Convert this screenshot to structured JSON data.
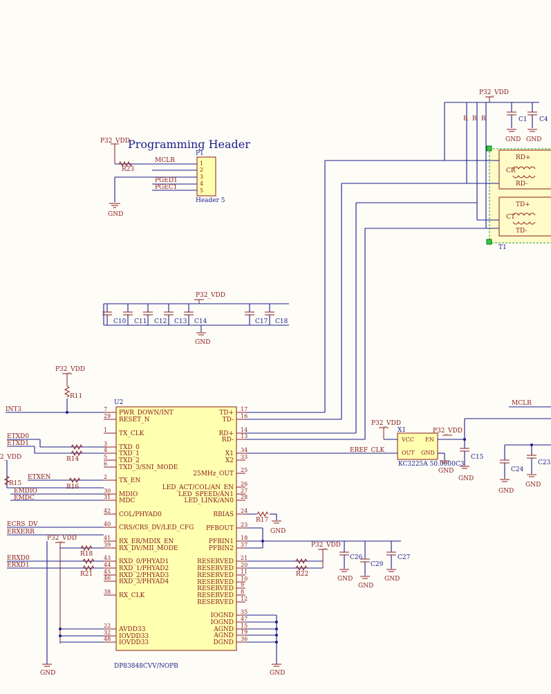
{
  "header": {
    "title": "Programming Header",
    "ref": "P1",
    "part": "Header 5",
    "pins": [
      "1",
      "2",
      "3",
      "4",
      "5"
    ],
    "nets": [
      "MCLR",
      "PGED1",
      "PGEC1"
    ]
  },
  "power": {
    "vdd": "P32_VDD",
    "gnd": "GND",
    "vdd_left": "2_VDD"
  },
  "caps_top": [
    "C1",
    "C4"
  ],
  "caps_bank": [
    "C10",
    "C11",
    "C12",
    "C13",
    "C14",
    "C17",
    "C18"
  ],
  "transformer": {
    "ref": "T1",
    "labels": [
      "RD+",
      "RD-",
      "TD+",
      "TD-"
    ],
    "cr": "CR",
    "ct": "CT"
  },
  "ic": {
    "ref": "U2",
    "part": "DP83848CVV/NOPB",
    "left_pins": [
      {
        "num": "7",
        "name": "PWR_DOWN/INT"
      },
      {
        "num": "29",
        "name": "RESET_N"
      },
      {
        "num": "1",
        "name": "TX_CLK"
      },
      {
        "num": "3",
        "name": "TXD_0"
      },
      {
        "num": "4",
        "name": "TXD_1"
      },
      {
        "num": "5",
        "name": "TXD_2"
      },
      {
        "num": "6",
        "name": "TXD_3/SNI_MODE"
      },
      {
        "num": "2",
        "name": "TX_EN"
      },
      {
        "num": "30",
        "name": "MDIO"
      },
      {
        "num": "31",
        "name": "MDC"
      },
      {
        "num": "42",
        "name": "COL/PHYAD0"
      },
      {
        "num": "40",
        "name": "CRS/CRS_DV/LED_CFG"
      },
      {
        "num": "41",
        "name": "RX_ER/MDIX_EN"
      },
      {
        "num": "39",
        "name": "RX_DV/MII_MODE"
      },
      {
        "num": "43",
        "name": "RXD_0/PHYAD1"
      },
      {
        "num": "44",
        "name": "RXD_1/PHYAD2"
      },
      {
        "num": "45",
        "name": "RXD_2/PHYAD3"
      },
      {
        "num": "46",
        "name": "RXD_3/PHYAD4"
      },
      {
        "num": "38",
        "name": "RX_CLK"
      },
      {
        "num": "22",
        "name": "AVDD33"
      },
      {
        "num": "32",
        "name": "IOVDD33"
      },
      {
        "num": "48",
        "name": "IOVDD33"
      }
    ],
    "right_pins": [
      {
        "num": "17",
        "name": "TD+"
      },
      {
        "num": "16",
        "name": "TD-"
      },
      {
        "num": "14",
        "name": "RD+"
      },
      {
        "num": "13",
        "name": "RD-"
      },
      {
        "num": "34",
        "name": "X1"
      },
      {
        "num": "33",
        "name": "X2"
      },
      {
        "num": "25",
        "name": "25MHz_OUT"
      },
      {
        "num": "26",
        "name": "LED_ACT/COL/AN_EN"
      },
      {
        "num": "27",
        "name": "LED_SPEED/AN1"
      },
      {
        "num": "28",
        "name": "LED_LINK/AN0"
      },
      {
        "num": "24",
        "name": "RBIAS"
      },
      {
        "num": "23",
        "name": "PFBOUT"
      },
      {
        "num": "18",
        "name": "PFBIN1"
      },
      {
        "num": "37",
        "name": "PFBIN2"
      },
      {
        "num": "21",
        "name": "RESERVED"
      },
      {
        "num": "20",
        "name": "RESERVED"
      },
      {
        "num": "11",
        "name": "RESERVED"
      },
      {
        "num": "10",
        "name": "RESERVED"
      },
      {
        "num": "9",
        "name": "RESERVED"
      },
      {
        "num": "8",
        "name": "RESERVED"
      },
      {
        "num": "12",
        "name": "RESERVED"
      },
      {
        "num": "35",
        "name": "IOGND"
      },
      {
        "num": "47",
        "name": "IOGND"
      },
      {
        "num": "15",
        "name": "AGND"
      },
      {
        "num": "19",
        "name": "AGND"
      },
      {
        "num": "36",
        "name": "DGND"
      }
    ]
  },
  "left_nets": [
    "INT3",
    "ETXD0",
    "ETXD1",
    "ETXEN",
    "EMDIO",
    "EMDC",
    "ECRS_DV",
    "ERXERR",
    "ERXD0",
    "ERXD1"
  ],
  "resistors": [
    "R23",
    "R11",
    "R14",
    "R15",
    "R16",
    "R17",
    "R18",
    "R21",
    "R22"
  ],
  "resistor_partial": [
    "R",
    "R",
    "R"
  ],
  "oscillator": {
    "ref": "X1",
    "part": "KC3225A 50.0000C3",
    "pins": [
      "VCC",
      "EN",
      "OUT",
      "GND"
    ],
    "net": "EREF_CLK"
  },
  "caps_misc": [
    "C15",
    "C23",
    "C24",
    "C26",
    "C27",
    "C29"
  ],
  "right_net": "MCLR"
}
